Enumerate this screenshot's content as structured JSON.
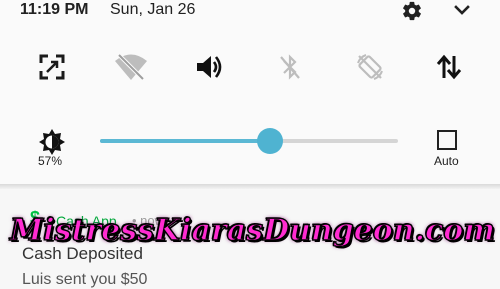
{
  "status_bar": {
    "time": "11:19 PM",
    "date": "Sun, Jan 26",
    "settings_icon": "gear-icon",
    "expand_icon": "chevron-down-icon"
  },
  "quick_tiles": [
    {
      "name": "screen-mirror",
      "icon": "screen-expand-icon",
      "state": "on"
    },
    {
      "name": "wifi",
      "icon": "wifi-off-icon",
      "state": "off"
    },
    {
      "name": "sound",
      "icon": "volume-icon",
      "state": "on"
    },
    {
      "name": "bluetooth",
      "icon": "bluetooth-off-icon",
      "state": "off"
    },
    {
      "name": "auto-rotate",
      "icon": "rotate-off-icon",
      "state": "off"
    },
    {
      "name": "mobile-data",
      "icon": "data-arrows-icon",
      "state": "on"
    }
  ],
  "brightness": {
    "label": "57%",
    "level": 0.57,
    "auto_label": "Auto",
    "accent_color": "#4fb3d1"
  },
  "notification": {
    "app_icon": "$",
    "app_name": "Cash App",
    "time": "• now",
    "title": "Cash Deposited",
    "body": "Luis sent you $50",
    "app_color": "#00c244"
  },
  "watermark": {
    "text": "MistressKiarasDungeon.com",
    "color": "#ff2bd1"
  }
}
